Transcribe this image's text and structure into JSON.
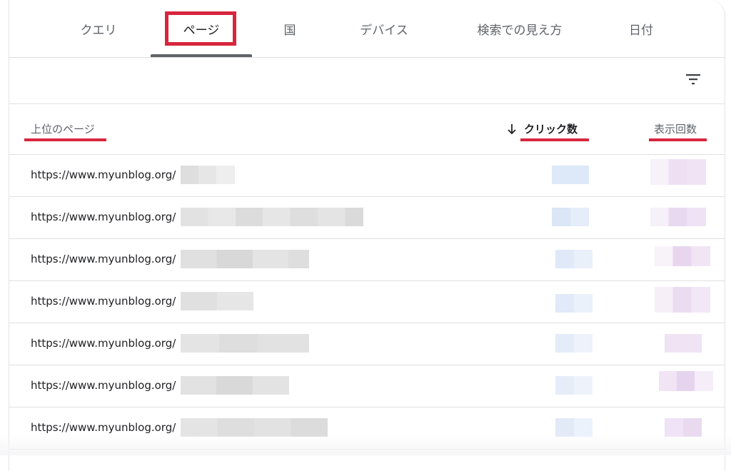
{
  "tabs": [
    {
      "label": "クエリ"
    },
    {
      "label": "ページ"
    },
    {
      "label": "国"
    },
    {
      "label": "デバイス"
    },
    {
      "label": "検索での見え方"
    },
    {
      "label": "日付"
    }
  ],
  "active_tab": "ページ",
  "toolbar": {
    "filter_icon": "filter-list-icon"
  },
  "table": {
    "columns": [
      {
        "label": "上位のページ"
      },
      {
        "label": "クリック数"
      },
      {
        "label": "表示回数"
      }
    ],
    "sort_icon": "arrow-down-icon",
    "rows": [
      {
        "url": "https://www.myunblog.org/"
      },
      {
        "url": "https://www.myunblog.org/"
      },
      {
        "url": "https://www.myunblog.org/"
      },
      {
        "url": "https://www.myunblog.org/"
      },
      {
        "url": "https://www.myunblog.org/"
      },
      {
        "url": "https://www.myunblog.org/"
      },
      {
        "url": "https://www.myunblog.org/"
      }
    ]
  },
  "colors": {
    "highlight": "#d7263d",
    "text_primary": "#202124",
    "text_secondary": "#5f6368",
    "divider": "#e0e0e0",
    "clicks_blur": "#dde8f8",
    "impressions_blur": "#ecdff2"
  }
}
